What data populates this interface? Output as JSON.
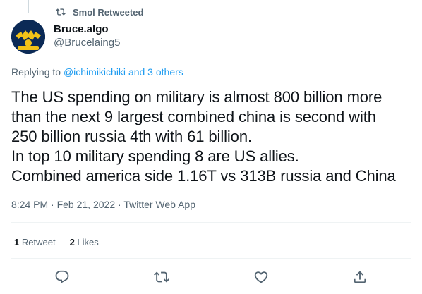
{
  "social_context": {
    "text": "Smol Retweeted",
    "icon": "retweet-icon"
  },
  "author": {
    "display_name": "Bruce.algo",
    "handle": "@Brucelaing5",
    "avatar_icon": "bat-logo-avatar"
  },
  "replying": {
    "prefix": "Replying to ",
    "mention": "@ichimikichiki",
    "others": "and 3 others"
  },
  "tweet": {
    "lines": [
      "The US spending on military is almost 800 billion more",
      "than the next 9 largest combined china is second with",
      "250 billion russia 4th with 61 billion.",
      "In top 10 military spending 8 are US allies.",
      "Combined america side 1.16T vs 313B russia and China"
    ]
  },
  "meta": {
    "time": "8:24 PM",
    "sep1": " · ",
    "date": "Feb 21, 2022",
    "sep2": " · ",
    "source": "Twitter Web App"
  },
  "stats": {
    "retweets_count": "1",
    "retweets_label": "Retweet",
    "likes_count": "2",
    "likes_label": "Likes"
  },
  "actions": [
    {
      "name": "reply",
      "icon": "reply-icon"
    },
    {
      "name": "retweet",
      "icon": "retweet-icon"
    },
    {
      "name": "like",
      "icon": "heart-icon"
    },
    {
      "name": "share",
      "icon": "share-icon"
    }
  ],
  "colors": {
    "link": "#1d9bf0",
    "muted": "#536471",
    "text": "#0f1419",
    "divider": "#eff3f4"
  }
}
